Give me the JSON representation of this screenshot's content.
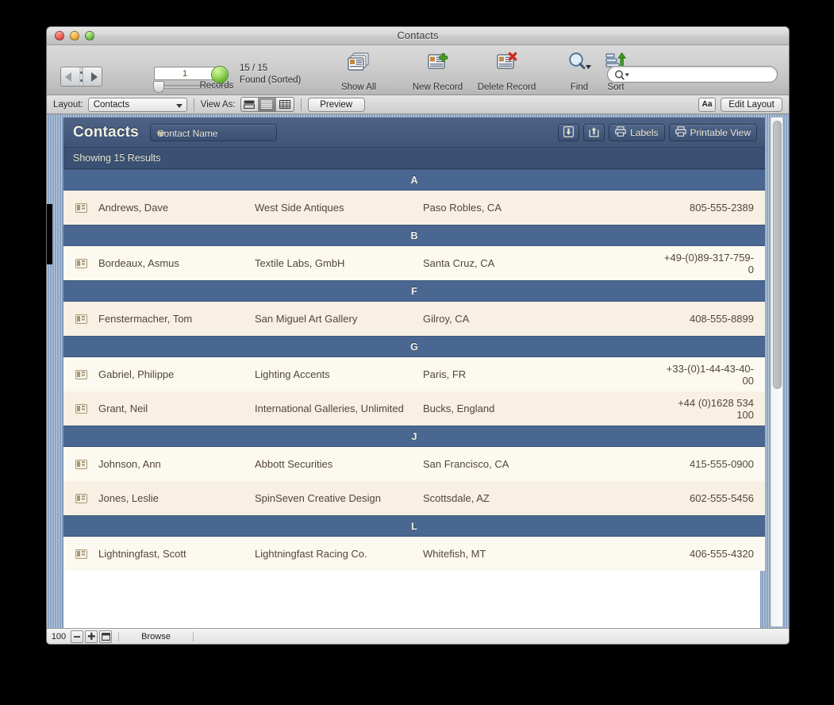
{
  "window": {
    "title": "Contacts",
    "traffic_lights": [
      "close",
      "minimize",
      "zoom"
    ]
  },
  "toolbar": {
    "record_value": "1",
    "records_label": "Records",
    "found_line1": "15 / 15",
    "found_line2": "Found (Sorted)",
    "buttons": [
      {
        "label": "Show All",
        "icon": "show-all-icon"
      },
      {
        "label": "New Record",
        "icon": "new-record-icon"
      },
      {
        "label": "Delete Record",
        "icon": "delete-record-icon"
      },
      {
        "label": "Find",
        "icon": "find-icon"
      },
      {
        "label": "Sort",
        "icon": "sort-icon"
      }
    ],
    "search_placeholder": ""
  },
  "layoutbar": {
    "layout_label": "Layout:",
    "layout_value": "Contacts",
    "view_as_label": "View As:",
    "view_modes": [
      "form-view",
      "list-view",
      "table-view"
    ],
    "view_mode_active": 1,
    "preview_label": "Preview",
    "text_format_label": "Aa",
    "edit_layout_label": "Edit Layout"
  },
  "panel": {
    "title": "Contacts",
    "sort_value": "Contact Name",
    "buttons": [
      {
        "label": "",
        "icon": "import-icon"
      },
      {
        "label": "",
        "icon": "export-icon"
      },
      {
        "label": "Labels",
        "icon": "printer-icon"
      },
      {
        "label": "Printable View",
        "icon": "printer-icon"
      }
    ],
    "results_text": "Showing 15 Results",
    "accent_header": "#3f5576",
    "accent_letter": "#4a6792",
    "row_colors": [
      "#f7f0e3",
      "#fcf9f0"
    ]
  },
  "list": {
    "groups": [
      {
        "letter": "A",
        "rows": [
          {
            "name": "Andrews, Dave",
            "company": "West Side Antiques",
            "city": "Paso Robles, CA",
            "phone": "805-555-2389"
          }
        ]
      },
      {
        "letter": "B",
        "rows": [
          {
            "name": "Bordeaux, Asmus",
            "company": "Textile Labs, GmbH",
            "city": "Santa Cruz, CA",
            "phone": "+49-(0)89-317-759-0"
          }
        ]
      },
      {
        "letter": "F",
        "rows": [
          {
            "name": "Fenstermacher, Tom",
            "company": "San Miguel Art Gallery",
            "city": "Gilroy, CA",
            "phone": "408-555-8899"
          }
        ]
      },
      {
        "letter": "G",
        "rows": [
          {
            "name": "Gabriel, Philippe",
            "company": "Lighting Accents",
            "city": "Paris, FR",
            "phone": "+33-(0)1-44-43-40-00"
          },
          {
            "name": "Grant, Neil",
            "company": "International Galleries, Unlimited",
            "city": "Bucks, England",
            "phone": "+44 (0)1628 534 100"
          }
        ]
      },
      {
        "letter": "J",
        "rows": [
          {
            "name": "Johnson, Ann",
            "company": "Abbott Securities",
            "city": "San Francisco, CA",
            "phone": "415-555-0900"
          },
          {
            "name": "Jones, Leslie",
            "company": "SpinSeven Creative Design",
            "city": "Scottsdale, AZ",
            "phone": "602-555-5456"
          }
        ]
      },
      {
        "letter": "L",
        "rows": [
          {
            "name": "Lightningfast, Scott",
            "company": "Lightningfast Racing Co.",
            "city": "Whitefish, MT",
            "phone": "406-555-4320"
          }
        ]
      }
    ]
  },
  "statusbar": {
    "zoom": "100",
    "zoom_out_icon": "minus-icon",
    "zoom_in_icon": "plus-icon",
    "toggle_icon": "window-toggle-icon",
    "mode": "Browse"
  }
}
